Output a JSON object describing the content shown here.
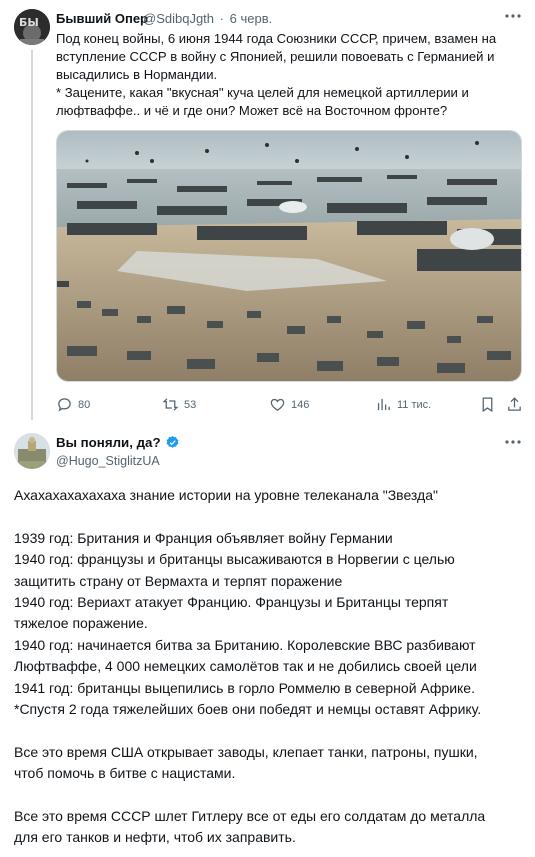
{
  "post1": {
    "author_name": "Бывший Опер",
    "author_handle": "@SdibqJgth",
    "separator": "·",
    "time": "6 черв.",
    "avatar_text": "БЫ",
    "text_para1": "Под конец войны, 6 июня 1944 года Союзники СССР, причем, взамен на вступление СССР в войну с Японией, решили повоевать с Германией и высадились в Нормандии.",
    "text_para2": "* Зацените, какая \"вкусная\" куча целей для немецкой артиллерии и люфтваффе.. и чё и где они? Может всё на Восточном фронте?",
    "replies": "80",
    "reposts": "53",
    "likes": "146",
    "views": "11 тис."
  },
  "post2": {
    "author_name": "Вы поняли, да?",
    "author_handle": "@Hugo_StiglitzUA",
    "lines": [
      "Ахахахахахахаха знание истории на уровне телеканала \"Звезда\"",
      "",
      "1939 год: Британия и Франция объявляет войну Германии",
      "1940 год: французы и британцы высаживаются в Норвегии с целью",
      "защитить страну от Вермахта и терпят поражение",
      "1940 год: Вериахт атакует Францию. Французы и Британцы терпят",
      "тяжелое поражение.",
      "1940 год: начинается битва за Британию. Королевские ВВС разбивают",
      "Люфтваффе, 4 000 немецких самолётов так и не добились своей цели",
      "1941 год: британцы выцепились в горло Роммелю в северной Африке.",
      "*Спустя 2 года тяжелейших боев они победят и немцы оставят Африку.",
      "",
      "Все это время США открывает заводы, клепает танки, патроны, пушки,",
      "чтоб помочь в битве с нацистами.",
      "",
      "Все это время СССР шлет Гитлеру все от еды его солдатам до металла",
      "для его танков и нефти, чтоб их заправить."
    ]
  },
  "colors": {
    "text": "#0f1419",
    "muted": "#536471",
    "verified": "#1d9bf0",
    "line": "#cfd9de"
  },
  "icons": [
    "more-icon",
    "reply-icon",
    "repost-icon",
    "like-icon",
    "views-icon",
    "bookmark-icon",
    "share-icon",
    "verified-badge-icon"
  ]
}
